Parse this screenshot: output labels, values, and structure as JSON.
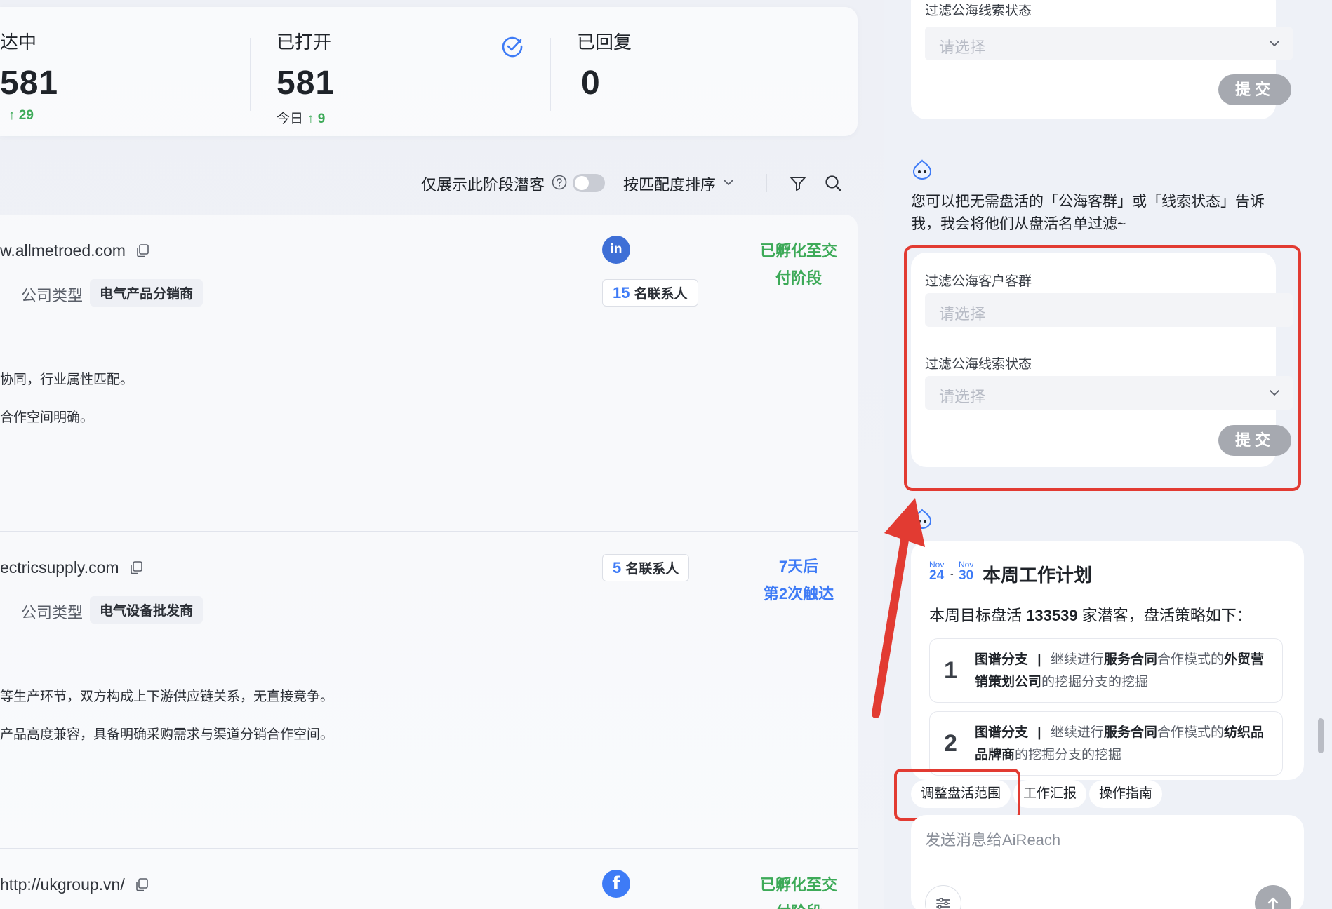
{
  "stats": {
    "reached": {
      "label": "达中",
      "value": "581",
      "delta": "↑ 29"
    },
    "opened": {
      "label": "已打开",
      "value": "581",
      "delta_prefix": "今日",
      "delta": "↑ 9"
    },
    "replied": {
      "label": "已回复",
      "value": "0"
    }
  },
  "toolbar": {
    "only_stage_label": "仅展示此阶段潜客",
    "sort_label": "按匹配度排序"
  },
  "leads": [
    {
      "domain": "w.allmetroed.com",
      "company_type_label": "公司类型",
      "company_type": "电气产品分销商",
      "reason1": "协同，行业属性匹配。",
      "reason2": "合作空间明确。",
      "contacts_num": "15",
      "contacts_label": "名联系人",
      "status_line1": "已孵化至交",
      "status_line2": "付阶段",
      "social": "in"
    },
    {
      "domain": "ectricsupply.com",
      "company_type_label": "公司类型",
      "company_type": "电气设备批发商",
      "reason1": "等生产环节，双方构成上下游供应链关系，无直接竞争。",
      "reason2": "产品高度兼容，具备明确采购需求与渠道分销合作空间。",
      "contacts_num": "5",
      "contacts_label": "名联系人",
      "status_line1": "7天后",
      "status_line2": "第2次触达"
    },
    {
      "domain": "http://ukgroup.vn/",
      "status_line1": "已孵化至交",
      "status_line2": "付阶段",
      "social": "f"
    }
  ],
  "right": {
    "prev_card": {
      "label": "过滤公海线索状态",
      "placeholder": "请选择",
      "submit": "提交"
    },
    "bot_message": "您可以把无需盘活的「公海客群」或「线索状态」告诉我，我会将他们从盘活名单过滤~",
    "filter_card": {
      "group_label": "过滤公海客户客群",
      "group_placeholder": "请选择",
      "status_label": "过滤公海线索状态",
      "status_placeholder": "请选择",
      "submit": "提交"
    },
    "plan": {
      "date_start_month": "Nov",
      "date_start_day": "24",
      "date_end_month": "Nov",
      "date_end_day": "30",
      "title": "本周工作计划",
      "goal_prefix": "本周目标盘活",
      "goal_count": "133539",
      "goal_suffix": "家潜客，盘活策略如下：",
      "items": [
        {
          "num": "1",
          "tag": "图谱分支",
          "sep": "|",
          "pre": "继续进行",
          "mode": "服务合同",
          "mid": "合作模式的",
          "target": "外贸营销策划公司",
          "post": "的挖掘分支的挖掘"
        },
        {
          "num": "2",
          "tag": "图谱分支",
          "sep": "|",
          "pre": "继续进行",
          "mode": "服务合同",
          "mid": "合作模式的",
          "target": "纺织品品牌商",
          "post": "的挖掘分支的挖掘"
        }
      ]
    },
    "chips": [
      "调整盘活范围",
      "工作汇报",
      "操作指南"
    ],
    "composer_placeholder": "发送消息给AiReach"
  },
  "colors": {
    "accent_blue": "#3e7bf6",
    "success_green": "#3daa58",
    "highlight_red": "#e23b32"
  }
}
